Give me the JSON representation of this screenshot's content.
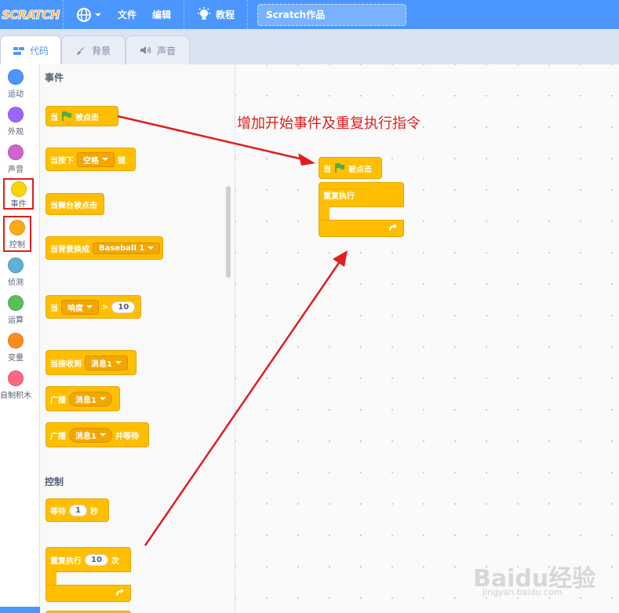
{
  "menubar": {
    "logo": "SCRATCH",
    "language_icon": "globe-icon",
    "file": "文件",
    "edit": "编辑",
    "tutorials": "教程",
    "project_title": "Scratch作品"
  },
  "tabs": [
    {
      "label": "代码",
      "icon": "code-icon"
    },
    {
      "label": "背景",
      "icon": "paintbrush-icon"
    },
    {
      "label": "声音",
      "icon": "speaker-icon"
    }
  ],
  "categories": [
    {
      "label": "运动",
      "color": "#4c97ff"
    },
    {
      "label": "外观",
      "color": "#9966ff"
    },
    {
      "label": "声音",
      "color": "#cf63cf"
    },
    {
      "label": "事件",
      "color": "#ffd500"
    },
    {
      "label": "控制",
      "color": "#ffab19"
    },
    {
      "label": "侦测",
      "color": "#5cb1d6"
    },
    {
      "label": "运算",
      "color": "#59c059"
    },
    {
      "label": "变量",
      "color": "#ff8c1a"
    },
    {
      "label": "自制积木",
      "color": "#ff6680"
    }
  ],
  "palette": {
    "events_title": "事件",
    "control_title": "控制",
    "when_flag_when": "当",
    "when_flag_clicked": "被点击",
    "when_key_pressed_a": "当按下",
    "when_key_pressed_key": "空格",
    "when_key_pressed_b": "键",
    "when_stage_clicked": "当舞台被点击",
    "when_backdrop_switches": "当背景换成",
    "backdrop_name": "Baseball 1",
    "when_label": "当",
    "loudness": "响度",
    "greater_than": ">",
    "loudness_value": "10",
    "when_receive": "当接收到",
    "message1": "消息1",
    "broadcast": "广播",
    "broadcast_wait": "广播",
    "and_wait": "并等待",
    "wait": "等待",
    "wait_value": "1",
    "seconds": "秒",
    "repeat": "重复执行",
    "repeat_value": "10",
    "times": "次"
  },
  "workspace": {
    "annotation": "增加开始事件及重复执行指令",
    "script_when": "当",
    "script_clicked": "被点击",
    "script_forever": "重复执行"
  },
  "watermark": {
    "brand": "Baidu经验",
    "url": "jingyan.baidu.com"
  }
}
